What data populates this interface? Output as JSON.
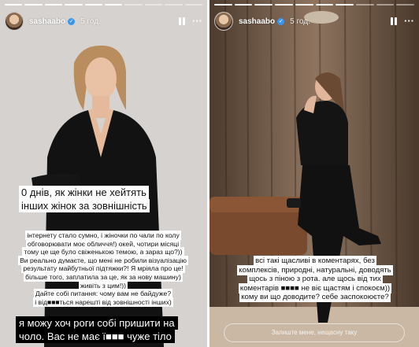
{
  "stories": [
    {
      "username": "sashaabo",
      "time": "5 год.",
      "title_lines": [
        "0 днів, як жінки не хейтять",
        "інших жінок за зовнішність"
      ],
      "body_lines": [
        "інтернету стало сумно, і жіночки по чали по колу",
        "обговорювати моє обличчя!) окей, чотири місяці",
        "тому це ще було свіженькою темою, а зараз що?))",
        "Ви реально думаєте, що мені не робили візуалізацію",
        "результату майбутньої підтяжки?! Я мріяла про це!",
        "більше того, заплатила за це, як за нову машину)",
        "живіть з цим!))",
        "Дайте собі питання: чому вам не байдуже?",
        "і від■■■ться нарешті від зовнішності інших)"
      ],
      "bottom_lines": [
        "я можу хоч роги собі пришити на",
        "чоло. Вас не має ї■■■ чуже тіло"
      ]
    },
    {
      "username": "sashaabo",
      "time": "5 год.",
      "body_lines": [
        "всі такі щасливі в коментарях, без",
        "комплексів, природні, натуральні, доводять",
        "щось з піною з рота. але щось від тих",
        "коментарів ■■■■ не віє щастям і спокоєм))",
        "кому ви що доводите? себе заспокоюєте?"
      ],
      "reply_placeholder": "Залиште мене, нещасну таку"
    }
  ],
  "icons": [
    "verified-icon",
    "pause-icon",
    "more-icon"
  ],
  "colors": {
    "caption_bg": "#ffffff",
    "caption_dark_bg": "#000000",
    "verified": "#3897f0"
  }
}
